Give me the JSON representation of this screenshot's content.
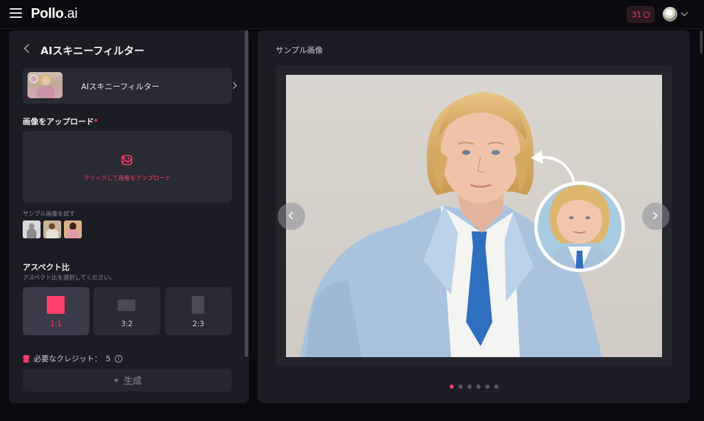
{
  "header": {
    "logo_main": "Pollo",
    "logo_suffix": ".ai",
    "credits": "31"
  },
  "left": {
    "title": "AIスキニーフィルター",
    "effect_name": "AIスキニーフィルター",
    "upload_label": "画像をアップロード",
    "upload_required": "*",
    "upload_prompt": "クリックして画像をアップロード",
    "sample_label": "サンプル画像を試す",
    "aspect_title": "アスペクト比",
    "aspect_subtitle": "アスペクト比を選択してください。",
    "aspect_options": [
      {
        "label": "1:1",
        "selected": true
      },
      {
        "label": "3:2",
        "selected": false
      },
      {
        "label": "2:3",
        "selected": false
      }
    ],
    "credits_text": "必要なクレジット：",
    "credits_value": "5",
    "generate_label": "生成"
  },
  "right": {
    "title": "サンプル画像",
    "carousel_pages": 6,
    "active_page": 1
  },
  "colors": {
    "accent": "#ff3d6e",
    "panel": "#1c1c24",
    "card": "#2a2a34",
    "background": "#0b0b0f"
  },
  "icons": [
    "menu-icon",
    "coin-icon",
    "avatar",
    "chevron-down-icon",
    "back-icon",
    "chevron-right-icon",
    "image-upload-icon",
    "coins-icon",
    "info-icon",
    "sparkle-icon",
    "arrow-left-icon",
    "arrow-right-icon"
  ]
}
